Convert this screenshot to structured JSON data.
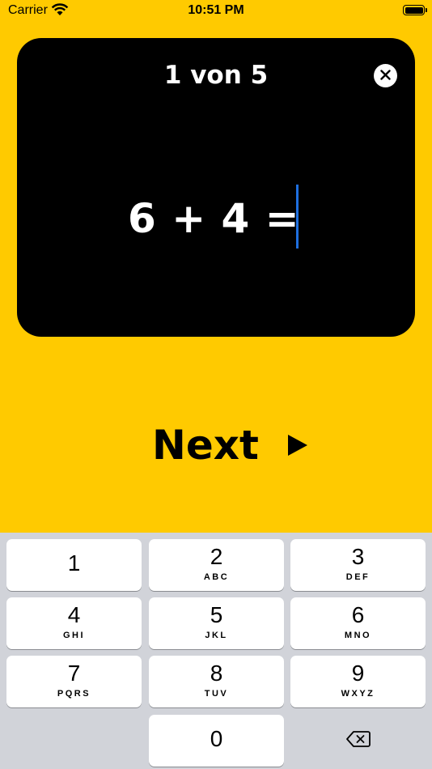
{
  "status_bar": {
    "carrier": "Carrier",
    "time": "10:51 PM"
  },
  "card": {
    "counter": "1 von 5",
    "equation": "6 + 4 ="
  },
  "next": {
    "label": "Next"
  },
  "keypad": {
    "keys": [
      {
        "num": "1",
        "letters": ""
      },
      {
        "num": "2",
        "letters": "ABC"
      },
      {
        "num": "3",
        "letters": "DEF"
      },
      {
        "num": "4",
        "letters": "GHI"
      },
      {
        "num": "5",
        "letters": "JKL"
      },
      {
        "num": "6",
        "letters": "MNO"
      },
      {
        "num": "7",
        "letters": "PQRS"
      },
      {
        "num": "8",
        "letters": "TUV"
      },
      {
        "num": "9",
        "letters": "WXYZ"
      },
      {
        "num": "0",
        "letters": ""
      }
    ]
  },
  "colors": {
    "background": "#FFCA00",
    "card": "#000000",
    "caret": "#1E6FE0",
    "keypad_bg": "#D1D3D9"
  }
}
